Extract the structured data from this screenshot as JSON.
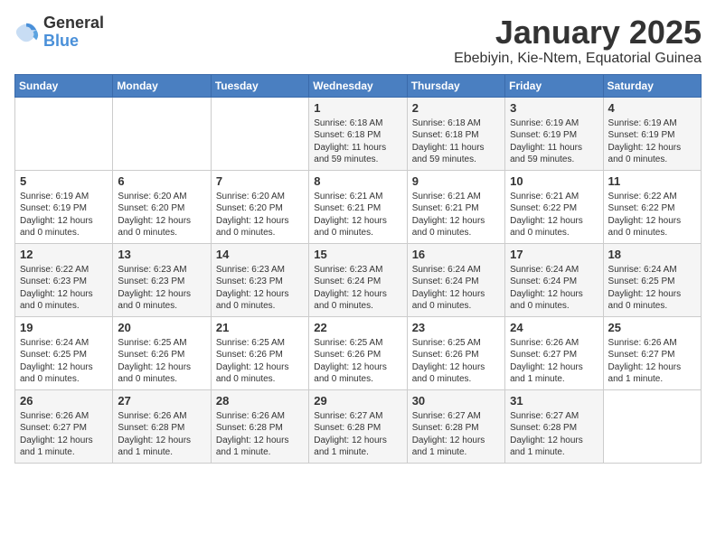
{
  "logo": {
    "general": "General",
    "blue": "Blue"
  },
  "header": {
    "title": "January 2025",
    "subtitle": "Ebebiyin, Kie-Ntem, Equatorial Guinea"
  },
  "weekdays": [
    "Sunday",
    "Monday",
    "Tuesday",
    "Wednesday",
    "Thursday",
    "Friday",
    "Saturday"
  ],
  "weeks": [
    [
      {
        "day": "",
        "info": ""
      },
      {
        "day": "",
        "info": ""
      },
      {
        "day": "",
        "info": ""
      },
      {
        "day": "1",
        "info": "Sunrise: 6:18 AM\nSunset: 6:18 PM\nDaylight: 11 hours and 59 minutes."
      },
      {
        "day": "2",
        "info": "Sunrise: 6:18 AM\nSunset: 6:18 PM\nDaylight: 11 hours and 59 minutes."
      },
      {
        "day": "3",
        "info": "Sunrise: 6:19 AM\nSunset: 6:19 PM\nDaylight: 11 hours and 59 minutes."
      },
      {
        "day": "4",
        "info": "Sunrise: 6:19 AM\nSunset: 6:19 PM\nDaylight: 12 hours and 0 minutes."
      }
    ],
    [
      {
        "day": "5",
        "info": "Sunrise: 6:19 AM\nSunset: 6:19 PM\nDaylight: 12 hours and 0 minutes."
      },
      {
        "day": "6",
        "info": "Sunrise: 6:20 AM\nSunset: 6:20 PM\nDaylight: 12 hours and 0 minutes."
      },
      {
        "day": "7",
        "info": "Sunrise: 6:20 AM\nSunset: 6:20 PM\nDaylight: 12 hours and 0 minutes."
      },
      {
        "day": "8",
        "info": "Sunrise: 6:21 AM\nSunset: 6:21 PM\nDaylight: 12 hours and 0 minutes."
      },
      {
        "day": "9",
        "info": "Sunrise: 6:21 AM\nSunset: 6:21 PM\nDaylight: 12 hours and 0 minutes."
      },
      {
        "day": "10",
        "info": "Sunrise: 6:21 AM\nSunset: 6:22 PM\nDaylight: 12 hours and 0 minutes."
      },
      {
        "day": "11",
        "info": "Sunrise: 6:22 AM\nSunset: 6:22 PM\nDaylight: 12 hours and 0 minutes."
      }
    ],
    [
      {
        "day": "12",
        "info": "Sunrise: 6:22 AM\nSunset: 6:23 PM\nDaylight: 12 hours and 0 minutes."
      },
      {
        "day": "13",
        "info": "Sunrise: 6:23 AM\nSunset: 6:23 PM\nDaylight: 12 hours and 0 minutes."
      },
      {
        "day": "14",
        "info": "Sunrise: 6:23 AM\nSunset: 6:23 PM\nDaylight: 12 hours and 0 minutes."
      },
      {
        "day": "15",
        "info": "Sunrise: 6:23 AM\nSunset: 6:24 PM\nDaylight: 12 hours and 0 minutes."
      },
      {
        "day": "16",
        "info": "Sunrise: 6:24 AM\nSunset: 6:24 PM\nDaylight: 12 hours and 0 minutes."
      },
      {
        "day": "17",
        "info": "Sunrise: 6:24 AM\nSunset: 6:24 PM\nDaylight: 12 hours and 0 minutes."
      },
      {
        "day": "18",
        "info": "Sunrise: 6:24 AM\nSunset: 6:25 PM\nDaylight: 12 hours and 0 minutes."
      }
    ],
    [
      {
        "day": "19",
        "info": "Sunrise: 6:24 AM\nSunset: 6:25 PM\nDaylight: 12 hours and 0 minutes."
      },
      {
        "day": "20",
        "info": "Sunrise: 6:25 AM\nSunset: 6:26 PM\nDaylight: 12 hours and 0 minutes."
      },
      {
        "day": "21",
        "info": "Sunrise: 6:25 AM\nSunset: 6:26 PM\nDaylight: 12 hours and 0 minutes."
      },
      {
        "day": "22",
        "info": "Sunrise: 6:25 AM\nSunset: 6:26 PM\nDaylight: 12 hours and 0 minutes."
      },
      {
        "day": "23",
        "info": "Sunrise: 6:25 AM\nSunset: 6:26 PM\nDaylight: 12 hours and 0 minutes."
      },
      {
        "day": "24",
        "info": "Sunrise: 6:26 AM\nSunset: 6:27 PM\nDaylight: 12 hours and 1 minute."
      },
      {
        "day": "25",
        "info": "Sunrise: 6:26 AM\nSunset: 6:27 PM\nDaylight: 12 hours and 1 minute."
      }
    ],
    [
      {
        "day": "26",
        "info": "Sunrise: 6:26 AM\nSunset: 6:27 PM\nDaylight: 12 hours and 1 minute."
      },
      {
        "day": "27",
        "info": "Sunrise: 6:26 AM\nSunset: 6:28 PM\nDaylight: 12 hours and 1 minute."
      },
      {
        "day": "28",
        "info": "Sunrise: 6:26 AM\nSunset: 6:28 PM\nDaylight: 12 hours and 1 minute."
      },
      {
        "day": "29",
        "info": "Sunrise: 6:27 AM\nSunset: 6:28 PM\nDaylight: 12 hours and 1 minute."
      },
      {
        "day": "30",
        "info": "Sunrise: 6:27 AM\nSunset: 6:28 PM\nDaylight: 12 hours and 1 minute."
      },
      {
        "day": "31",
        "info": "Sunrise: 6:27 AM\nSunset: 6:28 PM\nDaylight: 12 hours and 1 minute."
      },
      {
        "day": "",
        "info": ""
      }
    ]
  ]
}
